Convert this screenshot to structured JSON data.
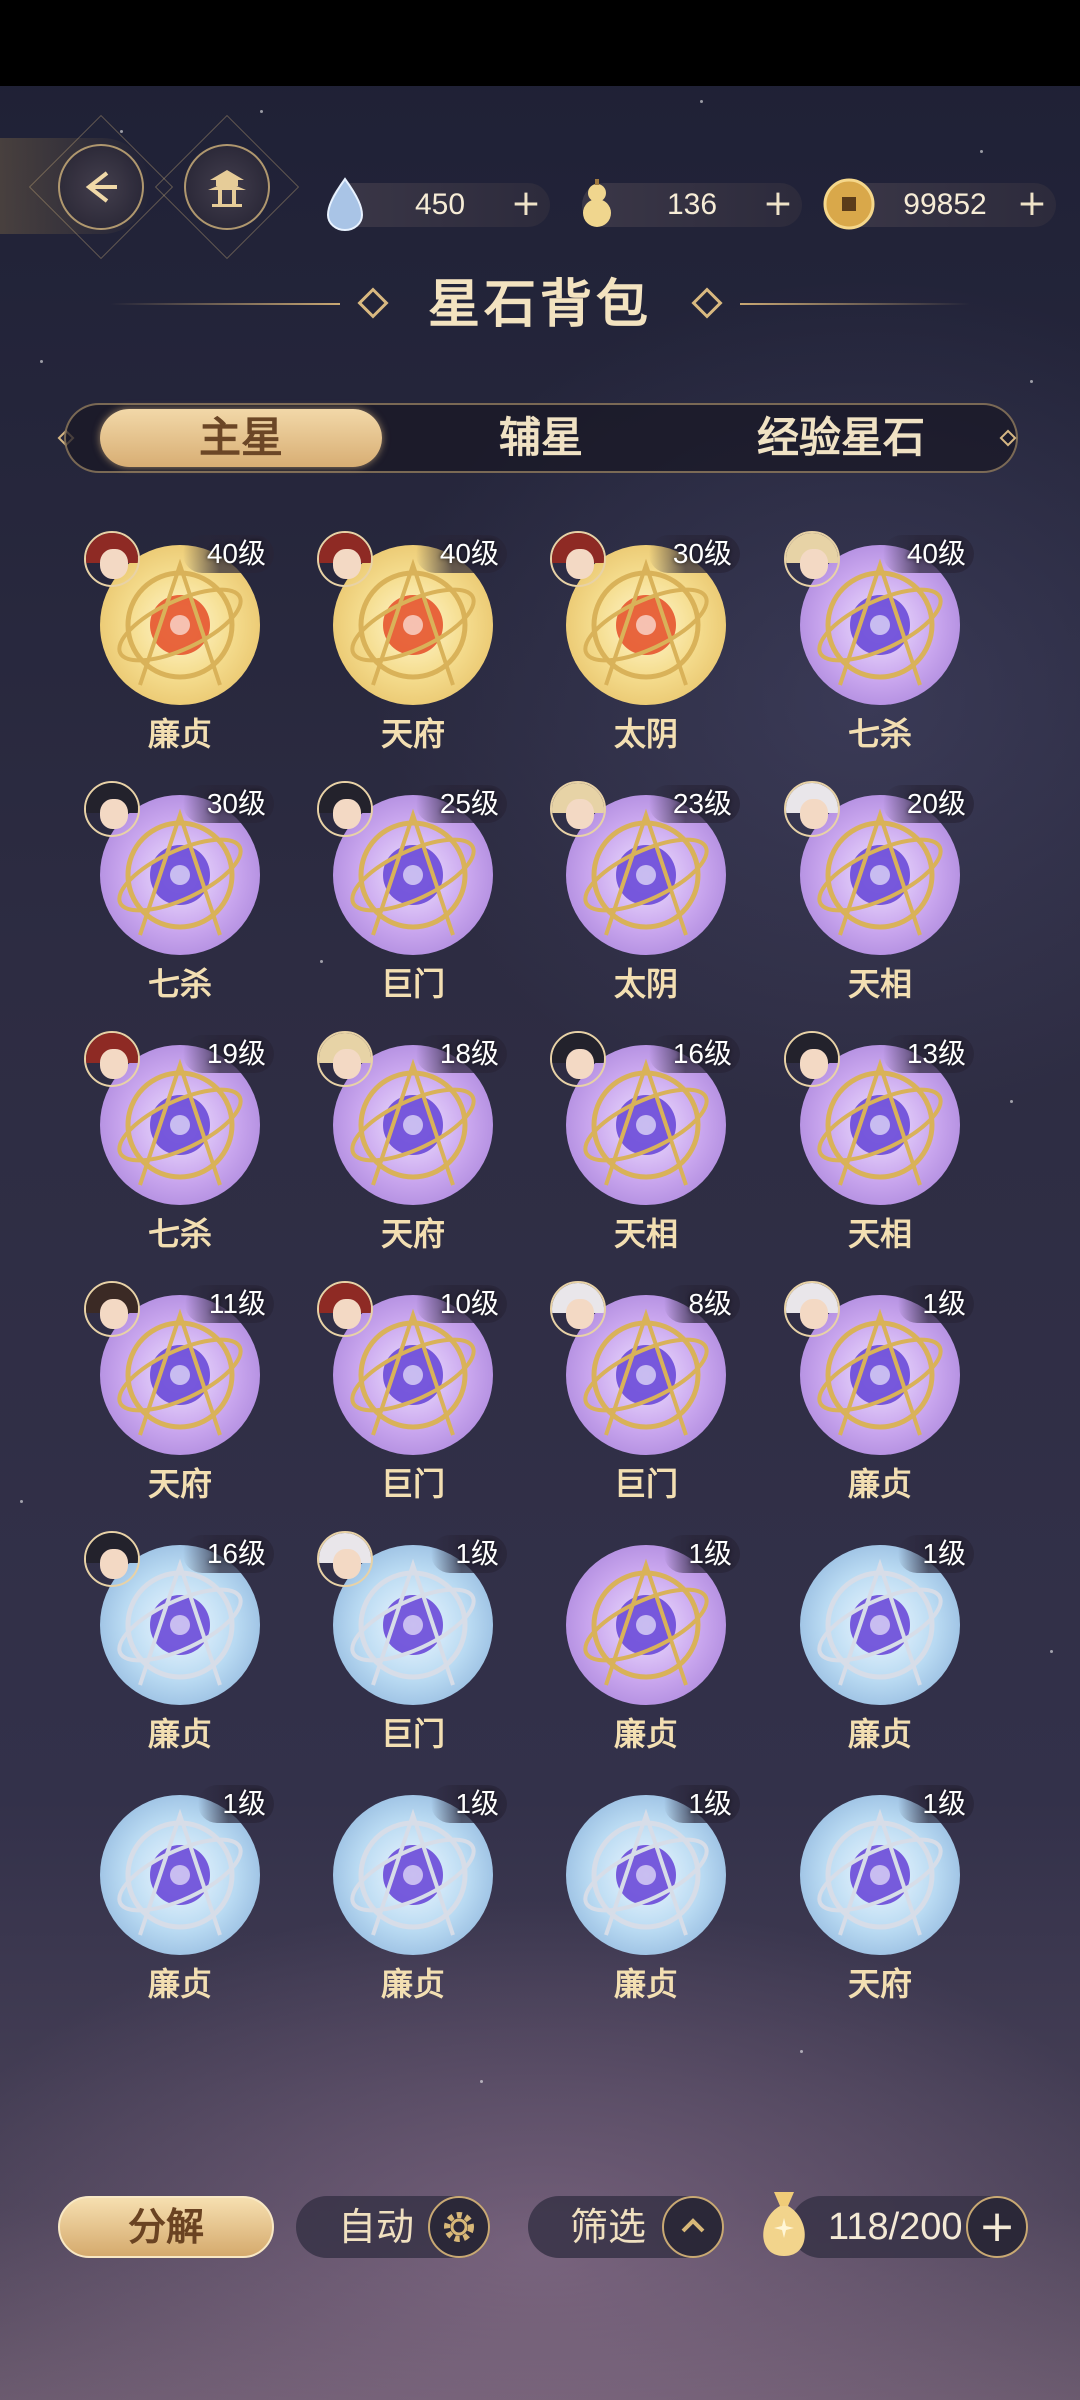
{
  "top_bar": {
    "back_icon": "back-arrow-icon",
    "home_icon": "pavilion-icon",
    "currencies": [
      {
        "name": "droplet-gem",
        "icon": "droplet-gem-icon",
        "value": "450"
      },
      {
        "name": "gourd",
        "icon": "gourd-icon",
        "value": "136"
      },
      {
        "name": "copper-coin",
        "icon": "copper-coin-icon",
        "value": "99852"
      }
    ],
    "plus_label": "+"
  },
  "page_title": "星石背包",
  "tabs": [
    {
      "label": "主星",
      "active": true
    },
    {
      "label": "辅星",
      "active": false
    },
    {
      "label": "经验星石",
      "active": false
    }
  ],
  "stones": [
    {
      "name": "廉贞",
      "level": "40级",
      "color": "gold",
      "avatar": "red"
    },
    {
      "name": "天府",
      "level": "40级",
      "color": "gold",
      "avatar": "red"
    },
    {
      "name": "太阴",
      "level": "30级",
      "color": "gold",
      "avatar": "red"
    },
    {
      "name": "七杀",
      "level": "40级",
      "color": "purple",
      "avatar": "blonde"
    },
    {
      "name": "七杀",
      "level": "30级",
      "color": "purple",
      "avatar": "dark"
    },
    {
      "name": "巨门",
      "level": "25级",
      "color": "purple",
      "avatar": "dark"
    },
    {
      "name": "太阴",
      "level": "23级",
      "color": "purple",
      "avatar": "blonde"
    },
    {
      "name": "天相",
      "level": "20级",
      "color": "purple",
      "avatar": "white"
    },
    {
      "name": "七杀",
      "level": "19级",
      "color": "purple",
      "avatar": "red"
    },
    {
      "name": "天府",
      "level": "18级",
      "color": "purple",
      "avatar": "blonde"
    },
    {
      "name": "天相",
      "level": "16级",
      "color": "purple",
      "avatar": "dark"
    },
    {
      "name": "天相",
      "level": "13级",
      "color": "purple",
      "avatar": "dark"
    },
    {
      "name": "天府",
      "level": "11级",
      "color": "purple",
      "avatar": "brown"
    },
    {
      "name": "巨门",
      "level": "10级",
      "color": "purple",
      "avatar": "red"
    },
    {
      "name": "巨门",
      "level": "8级",
      "color": "purple",
      "avatar": "white"
    },
    {
      "name": "廉贞",
      "level": "1级",
      "color": "purple",
      "avatar": "white"
    },
    {
      "name": "廉贞",
      "level": "16级",
      "color": "blue",
      "avatar": "dark"
    },
    {
      "name": "巨门",
      "level": "1级",
      "color": "blue",
      "avatar": "white"
    },
    {
      "name": "廉贞",
      "level": "1级",
      "color": "purple",
      "avatar": null
    },
    {
      "name": "廉贞",
      "level": "1级",
      "color": "blue",
      "avatar": null
    },
    {
      "name": "廉贞",
      "level": "1级",
      "color": "blue",
      "avatar": null
    },
    {
      "name": "廉贞",
      "level": "1级",
      "color": "blue",
      "avatar": null
    },
    {
      "name": "廉贞",
      "level": "1级",
      "color": "blue",
      "avatar": null
    },
    {
      "name": "天府",
      "level": "1级",
      "color": "blue",
      "avatar": null
    }
  ],
  "bottom_bar": {
    "decompose_label": "分解",
    "auto_label": "自动",
    "auto_icon": "gear-icon",
    "filter_label": "筛选",
    "filter_icon": "chevron-up-icon",
    "bag_icon": "money-bag-icon",
    "bag_count": "118/200",
    "add_label": "+"
  },
  "colors": {
    "accent_gold": "#d8ae74",
    "text_gold": "#f3dfb2",
    "orb_gold": "#f5dd8f",
    "orb_purple": "#c9a6ee",
    "orb_blue": "#b9daf2"
  }
}
